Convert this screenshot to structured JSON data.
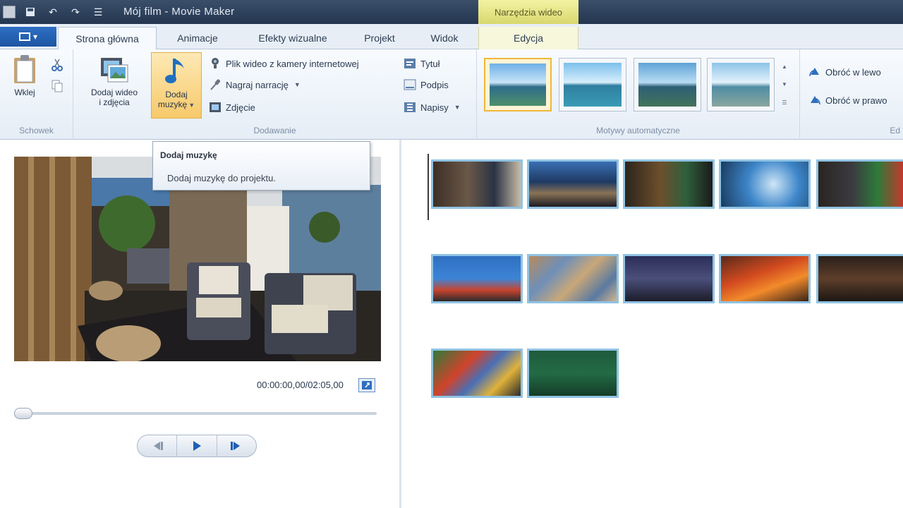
{
  "window": {
    "title": "Mój film - Movie Maker",
    "context_tab_header": "Narzędzia wideo"
  },
  "tabs": [
    {
      "label": "Strona główna",
      "active": true
    },
    {
      "label": "Animacje"
    },
    {
      "label": "Efekty wizualne"
    },
    {
      "label": "Projekt"
    },
    {
      "label": "Widok"
    },
    {
      "label": "Edycja",
      "context": true
    }
  ],
  "ribbon": {
    "clipboard": {
      "label": "Schowek",
      "paste": "Wklej"
    },
    "add": {
      "label": "Dodawanie",
      "add_videos_line1": "Dodaj wideo",
      "add_videos_line2": "i zdjęcia",
      "add_music_line1": "Dodaj",
      "add_music_line2": "muzykę",
      "webcam_video": "Plik wideo z kamery internetowej",
      "record_narration": "Nagraj narrację",
      "snapshot": "Zdjęcie",
      "title": "Tytuł",
      "caption": "Podpis",
      "credits": "Napisy"
    },
    "themes": {
      "label": "Motywy automatyczne"
    },
    "sharing": {
      "rotate_left": "Obróć w lewo",
      "rotate_right": "Obróć w prawo",
      "label_partial": "Ed"
    }
  },
  "tooltip": {
    "title": "Dodaj muzykę",
    "body": "Dodaj muzykę do projektu."
  },
  "preview": {
    "timecode": "00:00:00,00/02:05,00",
    "position_fraction": 0.0
  },
  "colors": {
    "accent_blue": "#1d55a3",
    "clip_border": "#90c3e3",
    "context_tab": "#e3e38a",
    "selection_gold": "#f0b73a"
  }
}
